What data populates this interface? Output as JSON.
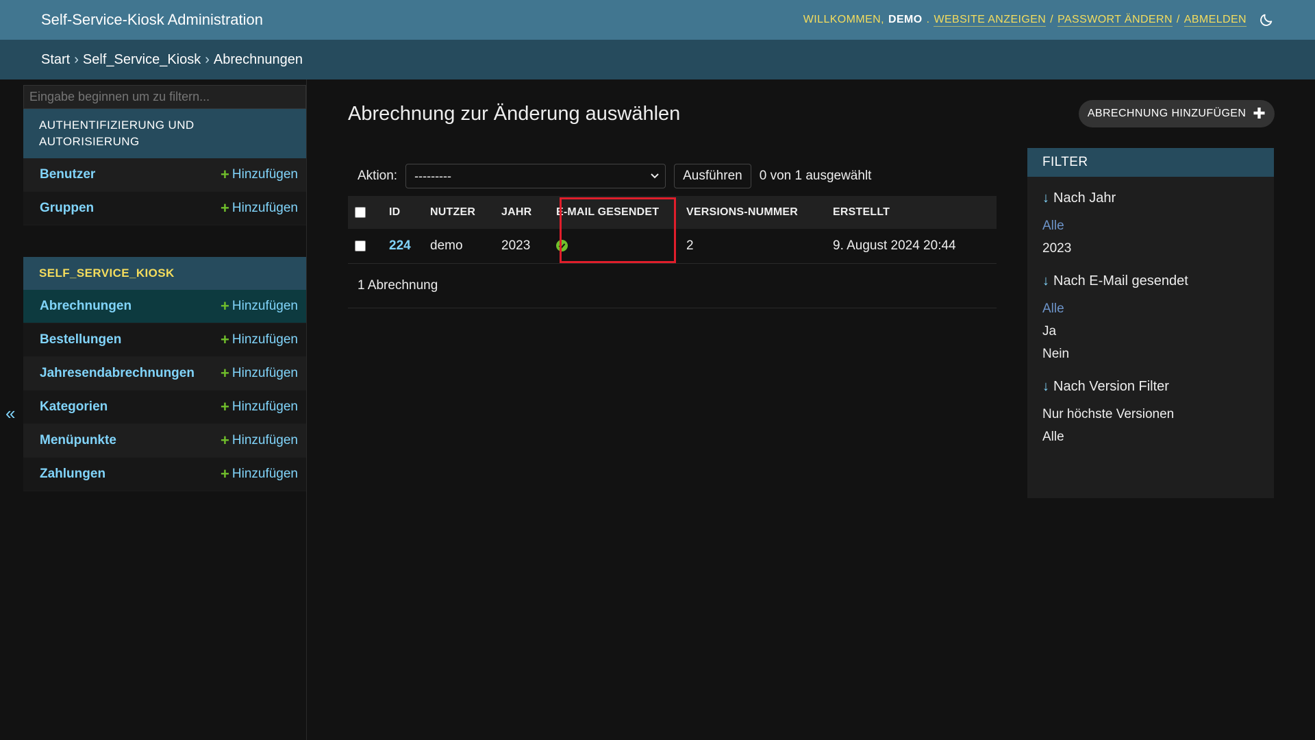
{
  "header": {
    "site_name": "Self-Service-Kiosk Administration",
    "welcome": "WILLKOMMEN,",
    "username": "DEMO",
    "view_site": "WEBSITE ANZEIGEN",
    "change_password": "PASSWORT ÄNDERN",
    "logout": "ABMELDEN",
    "sep": "/",
    "theme_icon": "moon-icon"
  },
  "breadcrumbs": {
    "home": "Start",
    "app": "Self_Service_Kiosk",
    "current": "Abrechnungen",
    "sep": "›"
  },
  "sidebar": {
    "filter_placeholder": "Eingabe beginnen um zu filtern...",
    "auth_caption": "Authentifizierung und Autorisierung",
    "auth_items": [
      {
        "label": "Benutzer",
        "add": "Hinzufügen"
      },
      {
        "label": "Gruppen",
        "add": "Hinzufügen"
      }
    ],
    "kiosk_caption": "Self_Service_Kiosk",
    "kiosk_items": [
      {
        "label": "Abrechnungen",
        "add": "Hinzufügen"
      },
      {
        "label": "Bestellungen",
        "add": "Hinzufügen"
      },
      {
        "label": "Jahresendabrechnungen",
        "add": "Hinzufügen"
      },
      {
        "label": "Kategorien",
        "add": "Hinzufügen"
      },
      {
        "label": "Menüpunkte",
        "add": "Hinzufügen"
      },
      {
        "label": "Zahlungen",
        "add": "Hinzufügen"
      }
    ],
    "toggle": "«"
  },
  "main": {
    "title": "Abrechnung zur Änderung auswählen",
    "add_button": "Abrechnung hinzufügen",
    "action_label": "Aktion:",
    "action_selected": "---------",
    "go_button": "Ausführen",
    "selection_count": "0 von 1 ausgewählt",
    "columns": [
      "ID",
      "Nutzer",
      "Jahr",
      "E-Mail gesendet",
      "Versions-Nummer",
      "Erstellt"
    ],
    "rows": [
      {
        "id": "224",
        "nutzer": "demo",
        "jahr": "2023",
        "email_sent": true,
        "version": "2",
        "erstellt": "9. August 2024 20:44"
      }
    ],
    "paginator": "1 Abrechnung"
  },
  "filter": {
    "title": "Filter",
    "groups": [
      {
        "title": "Nach Jahr",
        "options": [
          "Alle",
          "2023"
        ],
        "selected": 0
      },
      {
        "title": "Nach E-Mail gesendet",
        "options": [
          "Alle",
          "Ja",
          "Nein"
        ],
        "selected": 0
      },
      {
        "title": "Nach Version Filter",
        "options": [
          "Nur höchste Versionen",
          "Alle"
        ],
        "selected": -1
      }
    ],
    "arrow": "↓"
  },
  "colors": {
    "header_bg": "#417690",
    "breadcrumb_bg": "#264b5d",
    "link": "#81d4fa",
    "accent_yellow": "#f5dd5d",
    "add_green": "#70bf2b",
    "highlight_red": "#e01e2b"
  }
}
